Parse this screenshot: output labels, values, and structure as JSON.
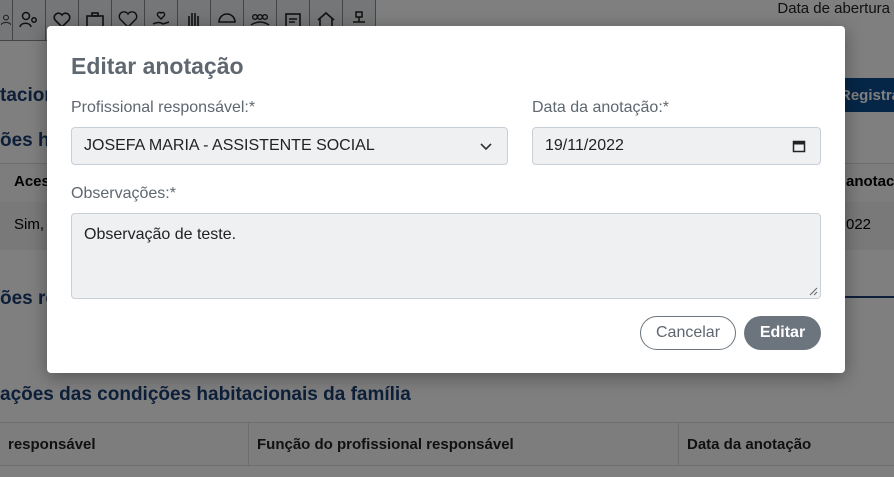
{
  "background": {
    "toolbar_icons": [
      "user-icon",
      "user-gear-icon",
      "heart-icon",
      "briefcase-icon",
      "heart-outline-icon",
      "hand-heart-icon",
      "hand-icon",
      "home-icon",
      "group-icon",
      "document-icon",
      "house-icon",
      "network-icon"
    ],
    "opening_date_label": "Data de abertura",
    "register_button": "Registra",
    "section_1": "tacion",
    "section_2": "ões ha",
    "table_header_1": "Aces",
    "table_header_2": "anotac",
    "table_cell_1": "Sim,",
    "table_cell_2": "022",
    "section_3": "ões re",
    "section_4": "ações das condições habitacionais da família",
    "bottom_columns": [
      "responsável",
      "Função do profissional responsável",
      "Data da anotação"
    ]
  },
  "modal": {
    "title": "Editar anotação",
    "professional_label": "Profissional responsável:*",
    "professional_value": "JOSEFA MARIA - ASSISTENTE SOCIAL",
    "date_label": "Data da anotação:*",
    "date_value": "19/11/2022",
    "observations_label": "Observações:*",
    "observations_value": "Observação de teste.",
    "cancel_button": "Cancelar",
    "edit_button": "Editar"
  },
  "colors": {
    "overlay": "rgba(0,0,0,0.5)",
    "brand_blue": "#1b3e72",
    "button_gray": "#6c757d",
    "field_bg": "#eef0f2"
  }
}
